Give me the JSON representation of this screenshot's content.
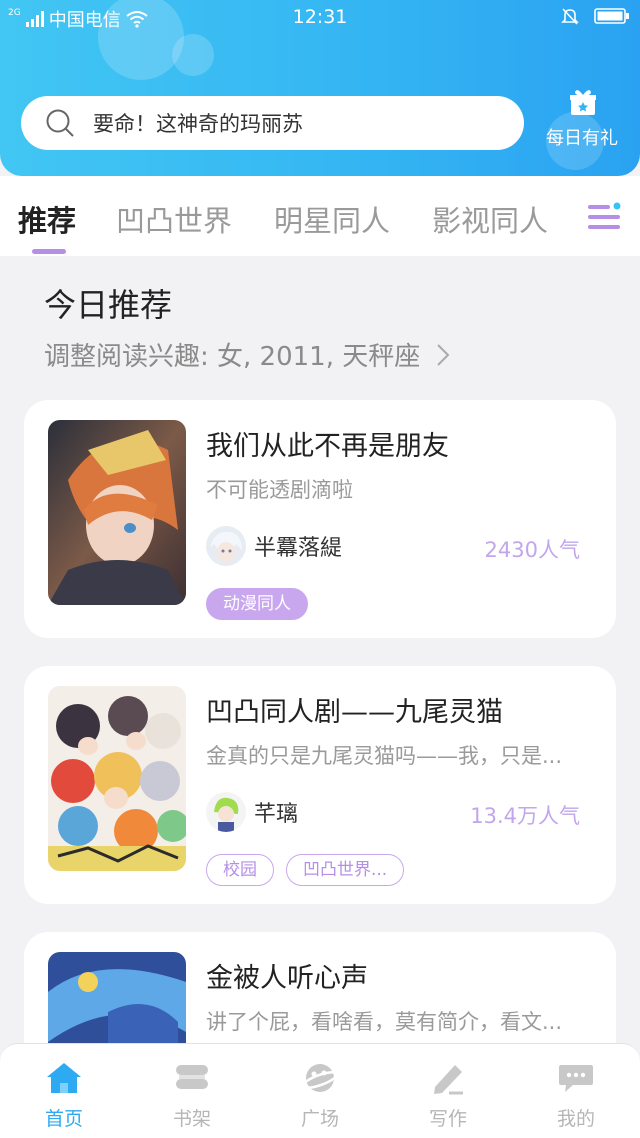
{
  "status_bar": {
    "carrier": "中国电信",
    "network": "2G",
    "time": "12:31"
  },
  "search": {
    "placeholder": "要命！这神奇的玛丽苏"
  },
  "daily_gift": {
    "label": "每日有礼"
  },
  "tabs": [
    {
      "label": "推荐",
      "active": true
    },
    {
      "label": "凹凸世界",
      "active": false
    },
    {
      "label": "明星同人",
      "active": false
    },
    {
      "label": "影视同人",
      "active": false
    }
  ],
  "section": {
    "title": "今日推荐",
    "interest": "调整阅读兴趣: 女, 2011, 天秤座"
  },
  "stories": [
    {
      "title": "我们从此不再是朋友",
      "desc": "不可能透剧滴啦",
      "author": "半羃落緹",
      "popularity": "2430人气",
      "tags": [
        {
          "label": "动漫同人",
          "style": "filled"
        }
      ]
    },
    {
      "title": "凹凸同人剧——九尾灵猫",
      "desc": "金真的只是九尾灵猫吗——我，只是...",
      "author": "芊璃",
      "popularity": "13.4万人气",
      "tags": [
        {
          "label": "校园",
          "style": "outline"
        },
        {
          "label": "凹凸世界...",
          "style": "outline"
        }
      ]
    },
    {
      "title": "金被人听心声",
      "desc": "讲了个屁，看啥看，莫有简介，看文...",
      "author": "",
      "popularity": "",
      "tags": []
    }
  ],
  "bottom_nav": [
    {
      "label": "首页",
      "icon": "home-icon",
      "active": true
    },
    {
      "label": "书架",
      "icon": "bookshelf-icon",
      "active": false
    },
    {
      "label": "广场",
      "icon": "planet-icon",
      "active": false
    },
    {
      "label": "写作",
      "icon": "pen-icon",
      "active": false
    },
    {
      "label": "我的",
      "icon": "chat-bubble-icon",
      "active": false
    }
  ],
  "colors": {
    "header": "#35b6f3",
    "accent_purple": "#b58fe6",
    "nav_active": "#2eaaf2"
  }
}
